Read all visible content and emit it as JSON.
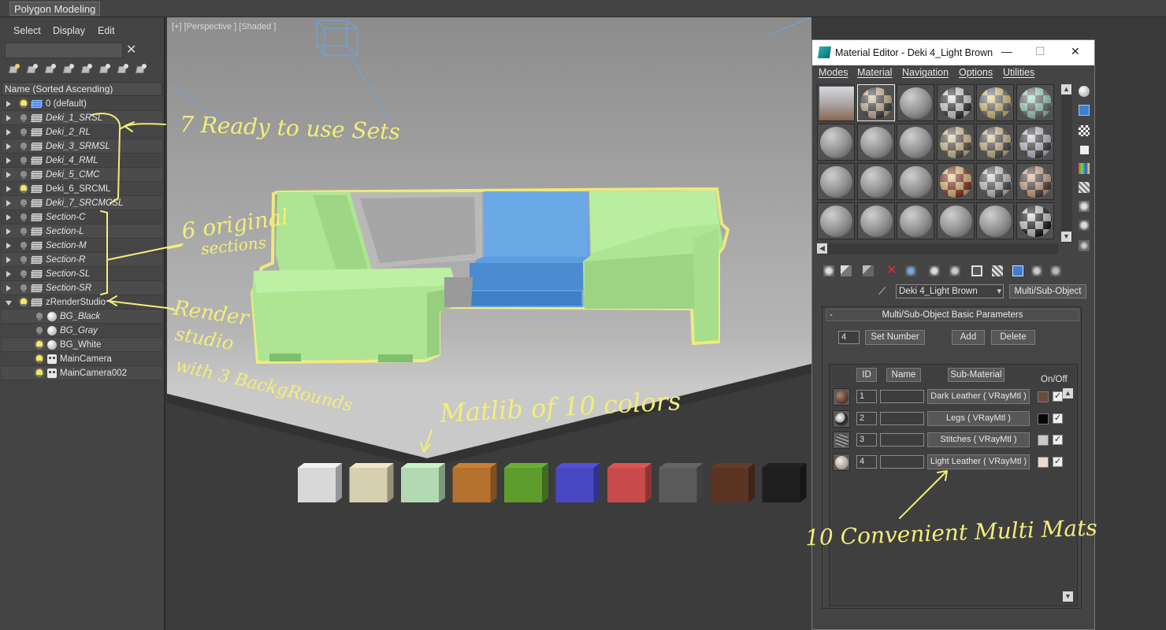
{
  "ribbon": {
    "tab_label": "Polygon Modeling"
  },
  "explorer": {
    "menu": [
      "Select",
      "Display",
      "Edit"
    ],
    "search_value": "",
    "column_header": "Name (Sorted Ascending)",
    "layers": [
      {
        "name": "0 (default)",
        "italic": false,
        "expanded": false,
        "indent": 0,
        "light_on": true,
        "icon": "layer-stack-icon-active"
      },
      {
        "name": "Deki_1_SRSL",
        "italic": true,
        "expanded": false,
        "indent": 0,
        "light_on": false,
        "icon": "layer-stack-icon"
      },
      {
        "name": "Deki_2_RL",
        "italic": true,
        "expanded": false,
        "indent": 0,
        "light_on": false,
        "icon": "layer-stack-icon"
      },
      {
        "name": "Deki_3_SRMSL",
        "italic": true,
        "expanded": false,
        "indent": 0,
        "light_on": false,
        "icon": "layer-stack-icon"
      },
      {
        "name": "Deki_4_RML",
        "italic": true,
        "expanded": false,
        "indent": 0,
        "light_on": false,
        "icon": "layer-stack-icon"
      },
      {
        "name": "Deki_5_CMC",
        "italic": true,
        "expanded": false,
        "indent": 0,
        "light_on": false,
        "icon": "layer-stack-icon"
      },
      {
        "name": "Deki_6_SRCML",
        "italic": false,
        "expanded": false,
        "indent": 0,
        "light_on": true,
        "icon": "layer-stack-icon"
      },
      {
        "name": "Deki_7_SRCMCSL",
        "italic": true,
        "expanded": false,
        "indent": 0,
        "light_on": false,
        "icon": "layer-stack-icon"
      },
      {
        "name": "Section-C",
        "italic": true,
        "expanded": false,
        "indent": 0,
        "light_on": false,
        "icon": "layer-stack-icon"
      },
      {
        "name": "Section-L",
        "italic": true,
        "expanded": false,
        "indent": 0,
        "light_on": false,
        "icon": "layer-stack-icon"
      },
      {
        "name": "Section-M",
        "italic": true,
        "expanded": false,
        "indent": 0,
        "light_on": false,
        "icon": "layer-stack-icon"
      },
      {
        "name": "Section-R",
        "italic": true,
        "expanded": false,
        "indent": 0,
        "light_on": false,
        "icon": "layer-stack-icon"
      },
      {
        "name": "Section-SL",
        "italic": true,
        "expanded": false,
        "indent": 0,
        "light_on": false,
        "icon": "layer-stack-icon"
      },
      {
        "name": "Section-SR",
        "italic": true,
        "expanded": false,
        "indent": 0,
        "light_on": false,
        "icon": "layer-stack-icon"
      },
      {
        "name": "zRenderStudio",
        "italic": false,
        "expanded": true,
        "indent": 0,
        "light_on": true,
        "icon": "layer-stack-icon"
      },
      {
        "name": "BG_Black",
        "italic": true,
        "expanded": false,
        "indent": 1,
        "light_on": false,
        "icon": "sphere-icon"
      },
      {
        "name": "BG_Gray",
        "italic": true,
        "expanded": false,
        "indent": 1,
        "light_on": false,
        "icon": "sphere-icon"
      },
      {
        "name": "BG_White",
        "italic": false,
        "expanded": false,
        "indent": 1,
        "light_on": true,
        "icon": "sphere-icon"
      },
      {
        "name": "MainCamera",
        "italic": false,
        "expanded": false,
        "indent": 1,
        "light_on": true,
        "icon": "camera-icon"
      },
      {
        "name": "MainCamera002",
        "italic": false,
        "expanded": false,
        "indent": 1,
        "light_on": true,
        "icon": "camera-icon"
      }
    ]
  },
  "viewport": {
    "label": "[+] [Perspective ] [Shaded ]",
    "swatches": [
      "#d8d8d8",
      "#d6cfb0",
      "#b3d9b3",
      "#b4722e",
      "#5e9c2c",
      "#4848c2",
      "#c84a4a",
      "#5a5a5a",
      "#5b3424",
      "#1e1e1e"
    ]
  },
  "annotations": {
    "sets": "7 Ready to use Sets",
    "sections_1": "6 original",
    "sections_2": "sections",
    "studio_1": "Render",
    "studio_2": "studio",
    "studio_3": "with 3 BackgRounds",
    "matlib": "Matlib of 10 colors",
    "multimats": "10 Convenient Multi Mats"
  },
  "material_editor": {
    "title": "Material Editor - Deki 4_Light Brown",
    "window_buttons": {
      "minimize": "—",
      "maximize": "☐",
      "close": "✕"
    },
    "menu": [
      "Modes",
      "Material",
      "Navigation",
      "Options",
      "Utilities"
    ],
    "current_material": "Deki 4_Light Brown",
    "material_type": "Multi/Sub-Object",
    "rollout_title": "Multi/Sub-Object Basic Parameters",
    "rollout_toggle": "-",
    "count_value": "4",
    "buttons": {
      "set_number": "Set Number",
      "add": "Add",
      "delete": "Delete"
    },
    "columns": {
      "id": "ID",
      "name": "Name",
      "sub_material": "Sub-Material",
      "on_off": "On/Off"
    },
    "sub_materials": [
      {
        "id": "1",
        "name": "",
        "material": "Dark Leather  ( VRayMtl )",
        "color": "#6b4a3a",
        "enabled": true
      },
      {
        "id": "2",
        "name": "",
        "material": "Legs  ( VRayMtl )",
        "color": "#050505",
        "enabled": true
      },
      {
        "id": "3",
        "name": "",
        "material": "Stitches  ( VRayMtl )",
        "color": "#c8c8c8",
        "enabled": true
      },
      {
        "id": "4",
        "name": "",
        "material": "Light Leather  ( VRayMtl )",
        "color": "#eadad0",
        "enabled": true
      }
    ],
    "checkmark": "✓",
    "scroll_up": "▲",
    "scroll_down": "▼",
    "scroll_left": "◀"
  }
}
